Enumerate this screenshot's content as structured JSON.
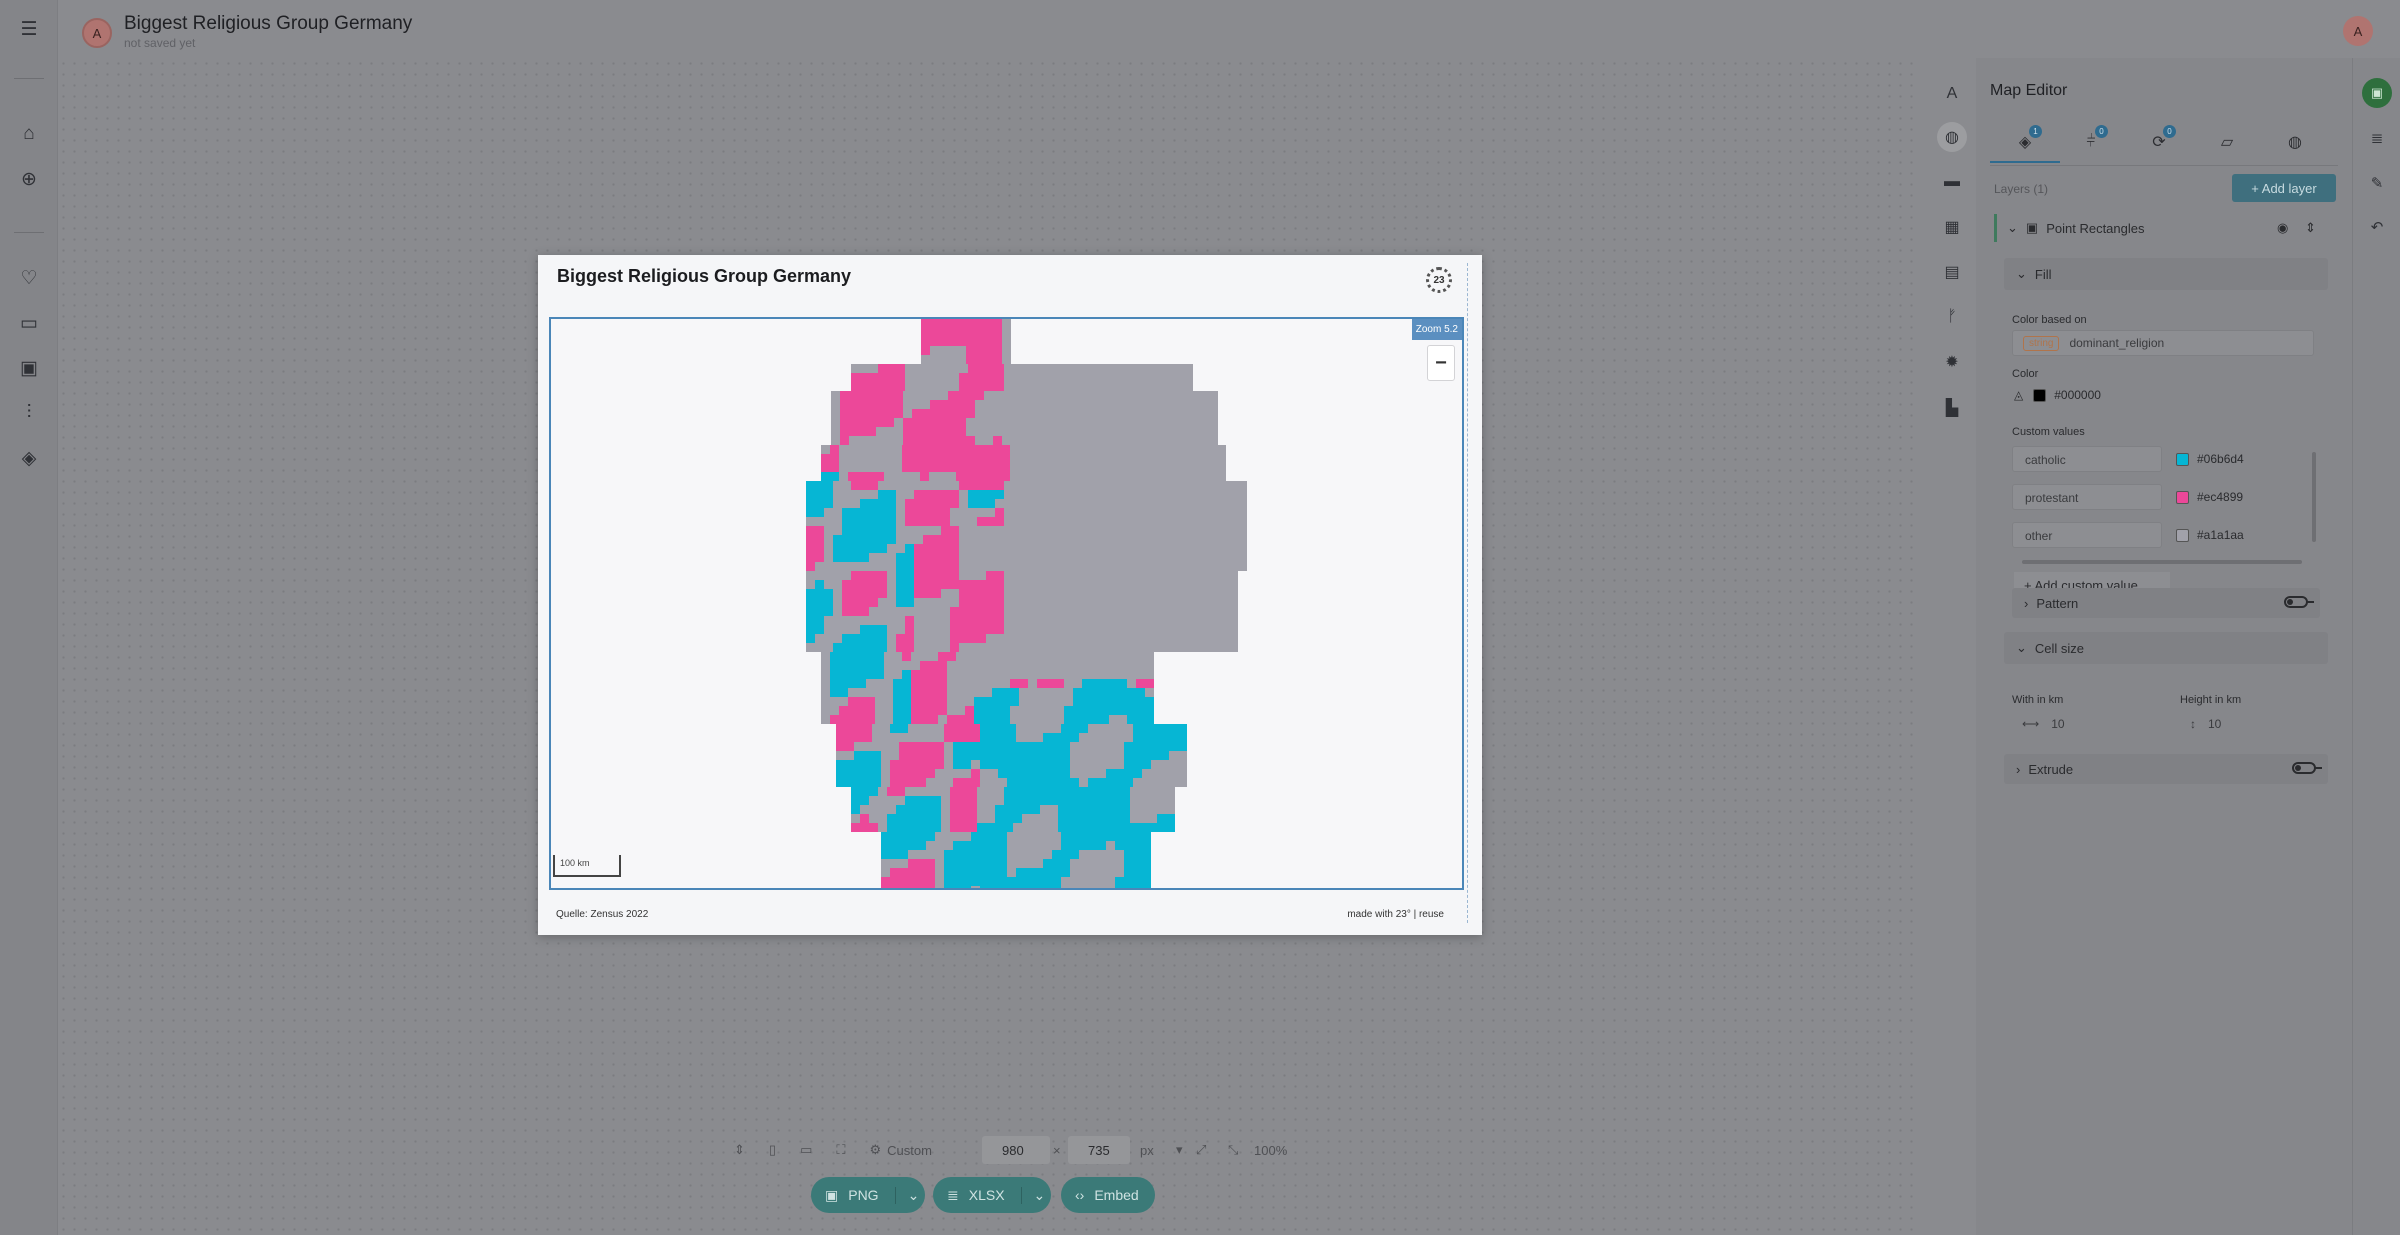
{
  "header": {
    "avatar_initial": "A",
    "title": "Biggest Religious Group Germany",
    "status": "not saved yet"
  },
  "nav": {
    "menu_icon": "menu-icon",
    "items": [
      "home-icon",
      "add-circle-icon",
      "heart-icon",
      "folder-icon",
      "image-icon",
      "sliders-icon",
      "layers-stack-icon"
    ]
  },
  "map": {
    "title": "Biggest Religious Group Germany",
    "logo_text": "23",
    "zoom_label": "Zoom 5.2",
    "zoom_minus": "−",
    "scale_label": "100 km",
    "source": "Quelle: Zensus 2022",
    "credit": "made with 23° | reuse",
    "colors": {
      "catholic": "#06b6d4",
      "protestant": "#ec4899",
      "other": "#a1a1aa"
    }
  },
  "bottom_bar": {
    "preset": "Custom",
    "width": "980",
    "x_sep": "×",
    "height": "735",
    "unit": "px",
    "zoom": "100%",
    "export_png": "PNG",
    "export_xlsx": "XLSX",
    "embed": "Embed"
  },
  "panel": {
    "title": "Map Editor",
    "tabs": [
      {
        "icon": "layers-icon",
        "count": "1"
      },
      {
        "icon": "filter-icon",
        "count": "0"
      },
      {
        "icon": "interaction-icon",
        "count": "0"
      },
      {
        "icon": "map-icon",
        "count": ""
      },
      {
        "icon": "globe-icon",
        "count": ""
      }
    ],
    "layers_label": "Layers (1)",
    "add_layer": "+ Add layer",
    "layer_name": "Point Rectangles",
    "fill_label": "Fill",
    "color_based_on_label": "Color based on",
    "type_tag": "string",
    "color_field": "dominant_religion",
    "color_label": "Color",
    "color_value": "#000000",
    "custom_values_label": "Custom values",
    "custom_values": [
      {
        "name": "catholic",
        "color": "#06b6d4"
      },
      {
        "name": "protestant",
        "color": "#ec4899"
      },
      {
        "name": "other",
        "color": "#a1a1aa"
      }
    ],
    "add_custom_value": "+ Add custom value",
    "pattern_label": "Pattern",
    "cell_size_label": "Cell size",
    "width_label": "With in km",
    "width_value": "10",
    "height_label": "Height in km",
    "height_value": "10",
    "extrude_label": "Extrude"
  }
}
